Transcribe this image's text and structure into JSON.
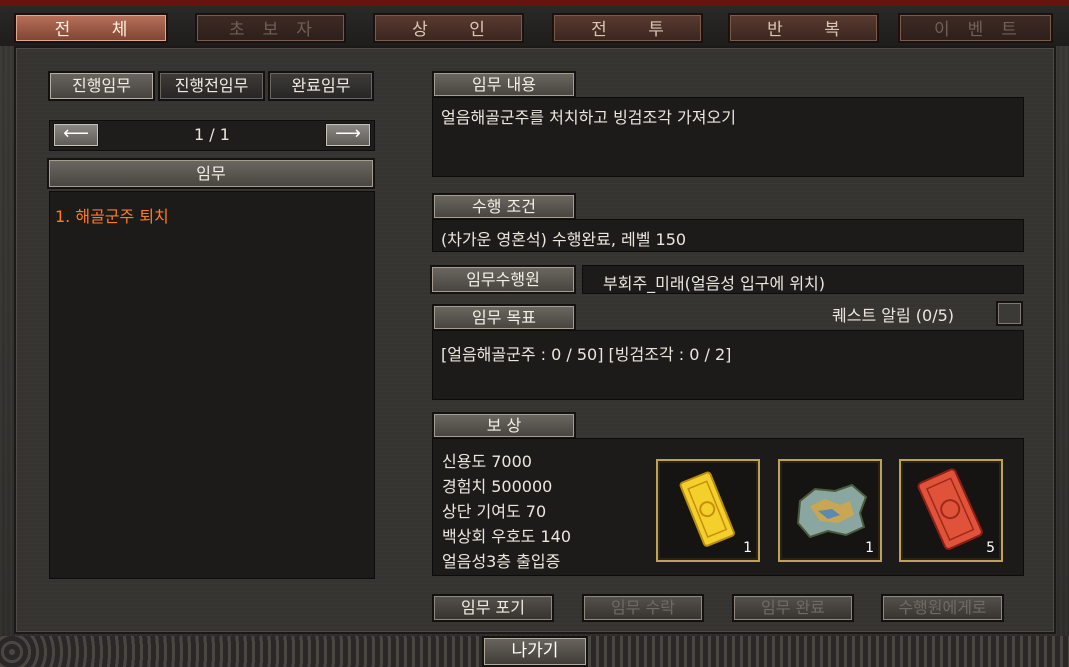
{
  "top_tabs": [
    {
      "label": "전 체",
      "state": "active"
    },
    {
      "label": "초보자",
      "state": "dim"
    },
    {
      "label": "상 인",
      "state": "normal"
    },
    {
      "label": "전 투",
      "state": "normal"
    },
    {
      "label": "반 복",
      "state": "normal"
    },
    {
      "label": "이벤트",
      "state": "dim"
    }
  ],
  "sub_tabs": [
    "진행임무",
    "진행전임무",
    "완료임무"
  ],
  "pager": {
    "prev_icon": "arrow-left-icon",
    "next_icon": "arrow-right-icon",
    "page": "1 / 1"
  },
  "quest_list": {
    "header": "임무",
    "items": [
      "1. 해골군주 퇴치"
    ]
  },
  "detail": {
    "content_label": "임무 내용",
    "content_text": "얼음해골군주를 처치하고 빙검조각 가져오기",
    "condition_label": "수행 조건",
    "condition_text": "(차가운 영혼석) 수행완료, 레벨 150",
    "npc_label": "임무수행원",
    "npc_text": "부회주_미래(얼음성 입구에 위치)",
    "goal_label": "임무 목표",
    "notify_text": "퀘스트 알림 (0/5)",
    "goal_text": "[얼음해골군주 : 0 / 50] [빙검조각 : 0 / 2]",
    "reward_label": "보 상",
    "rewards": [
      "신용도 7000",
      "경험치 500000",
      "상단 기여도 70",
      "백상회 우호도 140",
      "얼음성3층 출입증"
    ],
    "reward_items": [
      {
        "name": "yellow-scroll-icon",
        "count": "1"
      },
      {
        "name": "map-fragment-icon",
        "count": "1"
      },
      {
        "name": "red-scroll-icon",
        "count": "5"
      }
    ]
  },
  "buttons": {
    "giveup": "임무 포기",
    "accept": "임무 수락",
    "complete": "임무 완료",
    "to_npc": "수행원에게로"
  },
  "exit_label": "나가기",
  "colors": {
    "accent_orange": "#ff7a22",
    "tab_active": "#a6614d",
    "item_border": "#bfa25a"
  }
}
